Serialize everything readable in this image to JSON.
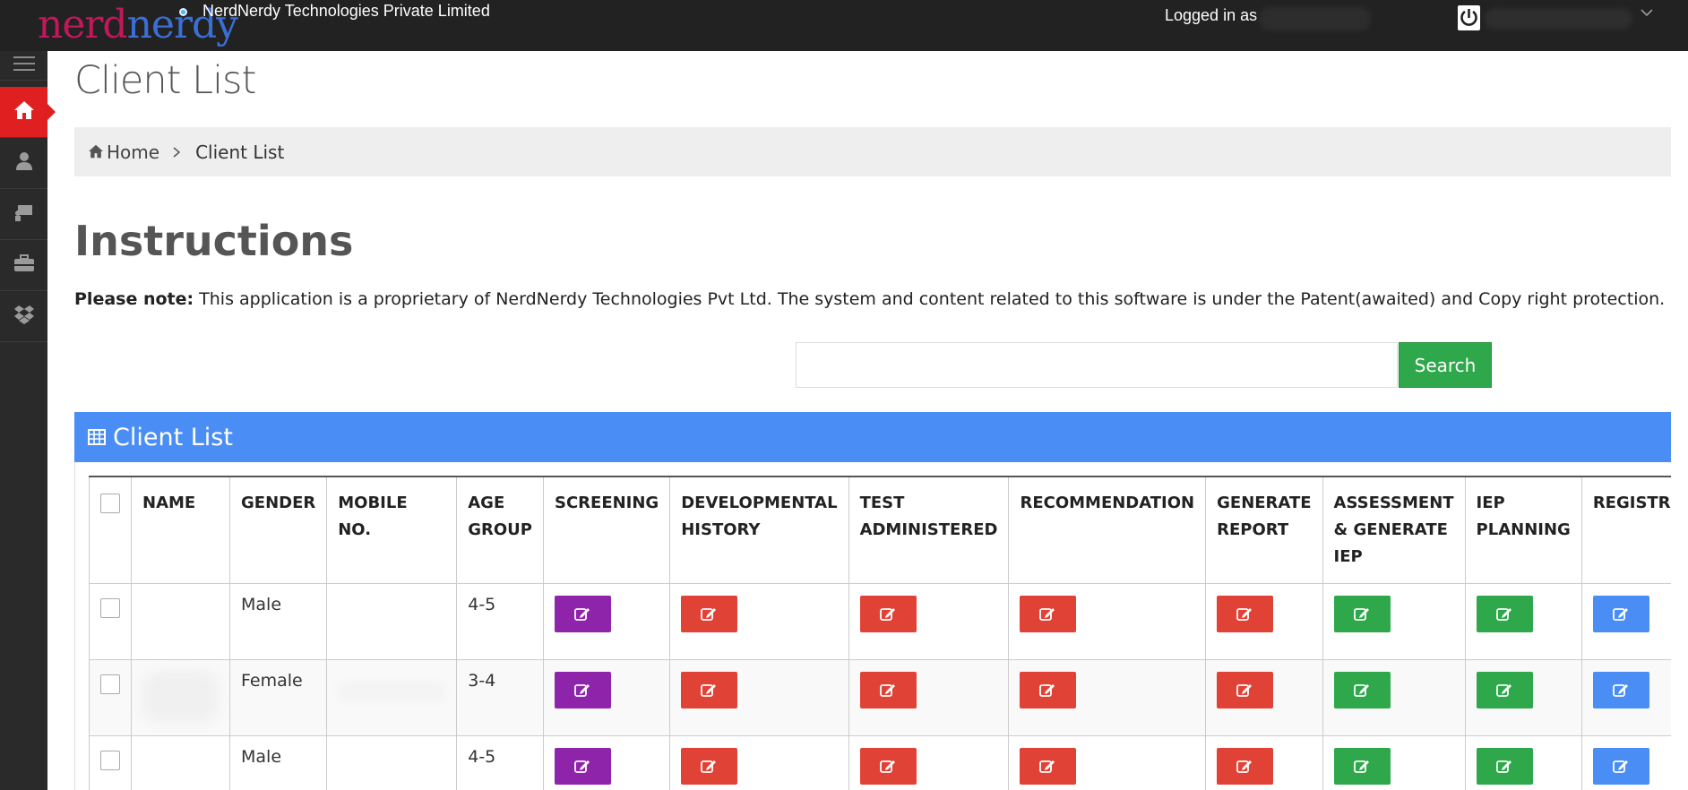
{
  "header": {
    "logo_part1": "nerd",
    "logo_part2": "nerdy",
    "company": "NerdNerdy Technologies Private Limited",
    "logged_in_label": "Logged in as"
  },
  "page": {
    "title": "Client List",
    "breadcrumb": {
      "home": "Home",
      "current": "Client List"
    },
    "instructions_title": "Instructions",
    "note_label": "Please note:",
    "note_text": " This application is a proprietary of NerdNerdy Technologies Pvt Ltd. The system and content related to this software is under the Patent(awaited) and Copy right protection.",
    "search_button": "Search",
    "search_placeholder": "",
    "panel_title": "Client List"
  },
  "table": {
    "headers": {
      "name": "NAME",
      "gender": "GENDER",
      "mobile_1": "MOBILE",
      "mobile_2": "NO.",
      "age_1": "AGE",
      "age_2": "GROUP",
      "screening": "SCREENING",
      "dev_1": "DEVELOPMENTAL",
      "dev_2": "HISTORY",
      "test_1": "TEST",
      "test_2": "ADMINISTERED",
      "recommendation": "RECOMMENDATION",
      "report_1": "GENERATE",
      "report_2": "REPORT",
      "assess_1": "ASSESSMENT",
      "assess_2": "& GENERATE",
      "assess_3": "IEP",
      "iep_1": "IEP",
      "iep_2": "PLANNING",
      "registration": "REGISTRATION"
    },
    "rows": [
      {
        "gender": "Male",
        "age": "4-5"
      },
      {
        "gender": "Female",
        "age": "3-4"
      },
      {
        "gender": "Male",
        "age": "4-5"
      }
    ]
  },
  "colors": {
    "purple": "#8e24aa",
    "red": "#e04236",
    "green": "#2ea84a",
    "blue": "#4a8ef5"
  },
  "icons": [
    "menu-icon",
    "home-icon",
    "user-icon",
    "chalkboard-icon",
    "briefcase-icon",
    "dropbox-icon",
    "power-icon",
    "chevron-down-icon",
    "grid-icon",
    "edit-icon"
  ]
}
